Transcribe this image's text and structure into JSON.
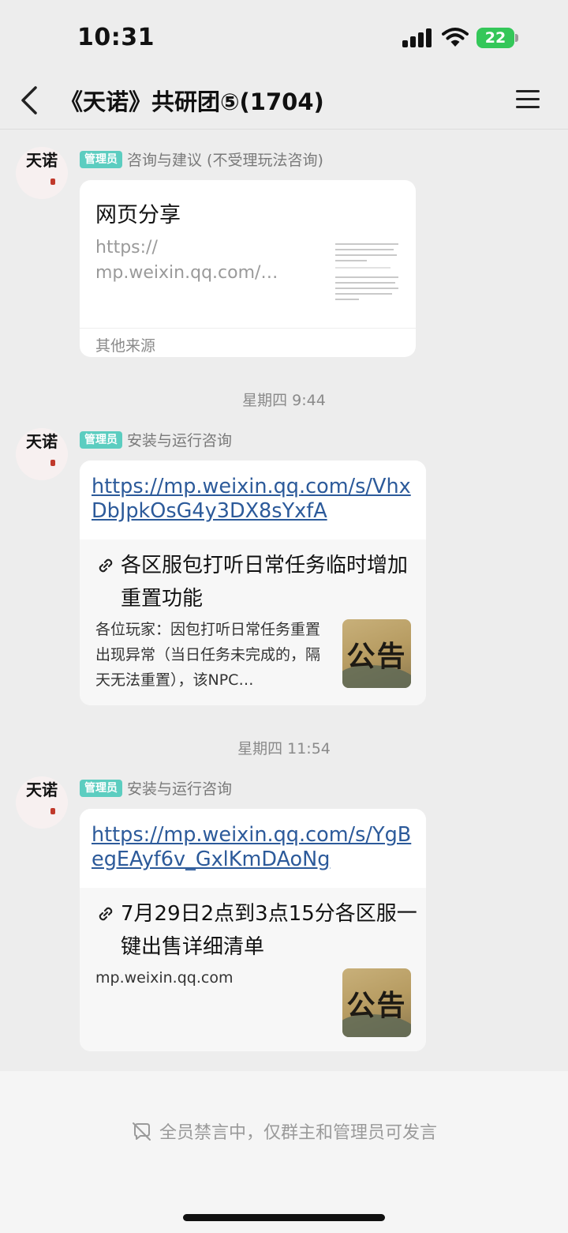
{
  "status_bar": {
    "time": "10:31",
    "battery": "22"
  },
  "nav": {
    "title": "《天诺》共研团⑤(1704)"
  },
  "avatar_glyph": "天诺",
  "messages": [
    {
      "badge": "管理员",
      "sender": "咨询与建议 (不受理玩法咨询)",
      "card": {
        "type": "web_share",
        "title": "网页分享",
        "url": "https://\nmp.weixin.qq.com/…",
        "source": "其他来源"
      }
    },
    {
      "timestamp": "星期四 9:44",
      "badge": "管理员",
      "sender": "安装与运行咨询",
      "card": {
        "type": "link",
        "url": "https://mp.weixin.qq.com/s/VhxDbJpkOsG4y3DX8sYxfA",
        "preview_title": "各区服包打听日常任务临时增加重置功能",
        "preview_desc": "各位玩家：因包打听日常任务重置出现异常（当日任务未完成的，隔天无法重置），该NPC…",
        "thumb_text": "公告"
      }
    },
    {
      "timestamp": "星期四 11:54",
      "badge": "管理员",
      "sender": "安装与运行咨询",
      "card": {
        "type": "link",
        "url": "https://mp.weixin.qq.com/s/YgBegEAyf6v_GxlKmDAoNg",
        "preview_title": "7月29日2点到3点15分各区服一键出售详细清单",
        "preview_domain": "mp.weixin.qq.com",
        "thumb_text": "公告"
      }
    }
  ],
  "footer": {
    "mute_text": "全员禁言中，仅群主和管理员可发言"
  },
  "colors": {
    "badge": "#5ccdc0",
    "link": "#2c5a9a",
    "background": "#ededed",
    "battery": "#34c759"
  }
}
